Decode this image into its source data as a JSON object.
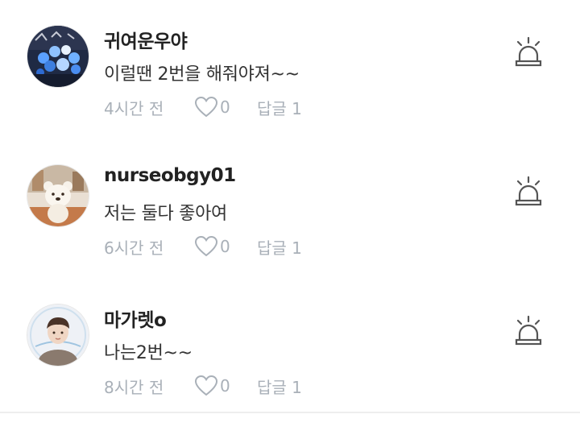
{
  "comments": [
    {
      "author": "귀여운우야",
      "text": "이럴땐 2번을 해줘야져~~",
      "time": "4시간 전",
      "likes": "0",
      "reply": "답글 1",
      "avatar_icon": "avatar-blue-lights-icon"
    },
    {
      "author": "nurseobgy01",
      "text": "저는 둘다 좋아여",
      "time": "6시간 전",
      "likes": "0",
      "reply": "답글 1",
      "avatar_icon": "avatar-bear-icon"
    },
    {
      "author": "마가렛o",
      "text": "나는2번~~",
      "time": "8시간 전",
      "likes": "0",
      "reply": "답글 1",
      "avatar_icon": "avatar-person-icon"
    }
  ],
  "icons": {
    "like": "heart-icon",
    "report": "siren-icon"
  },
  "colors": {
    "meta_gray": "#a9b0b8",
    "author": "#222222",
    "text": "#333333",
    "icon": "#555555"
  }
}
